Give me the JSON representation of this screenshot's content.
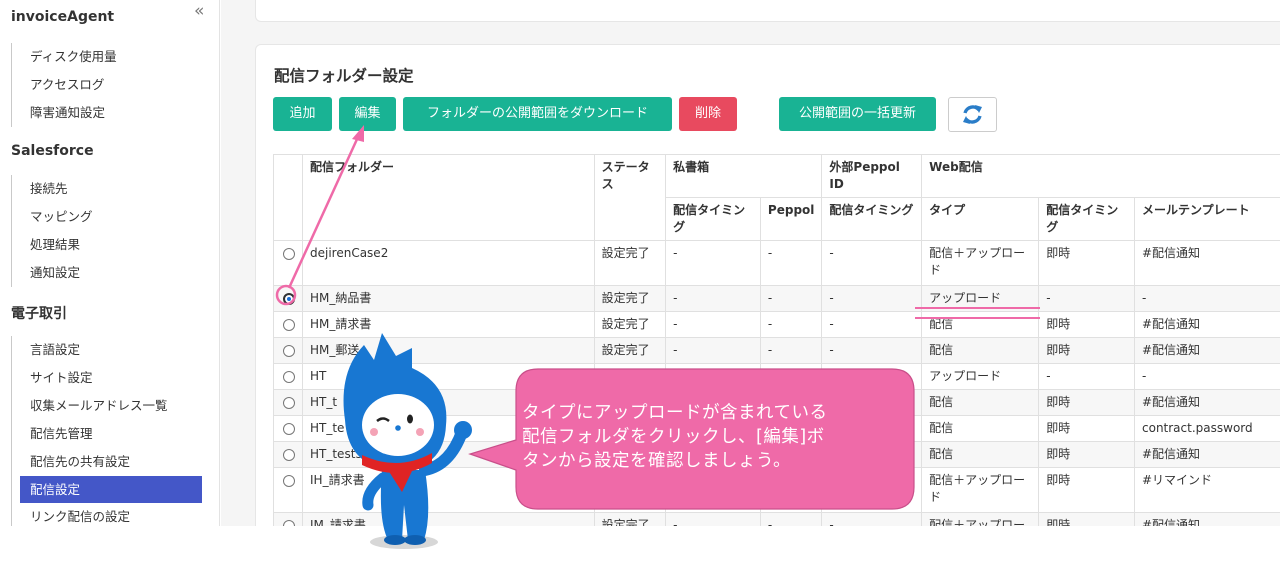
{
  "app": {
    "title": "invoiceAgent"
  },
  "sidebar": {
    "group1": [
      "ディスク使用量",
      "アクセスログ",
      "障害通知設定"
    ],
    "section_salesforce": "Salesforce",
    "group2": [
      "接続先",
      "マッピング",
      "処理結果",
      "通知設定"
    ],
    "section_edi": "電子取引",
    "group3": [
      "言語設定",
      "サイト設定",
      "収集メールアドレス一覧",
      "配信先管理",
      "配信先の共有設定",
      "配信設定",
      "リンク配信の設定"
    ],
    "active_item": "配信設定"
  },
  "main": {
    "title": "配信フォルダー設定",
    "buttons": {
      "add": "追加",
      "edit": "編集",
      "download": "フォルダーの公開範囲をダウンロード",
      "delete": "削除",
      "bulk_update": "公開範囲の一括更新"
    },
    "table": {
      "headers": {
        "folder": "配信フォルダー",
        "status": "ステータス",
        "private_box": "私書箱",
        "external_peppol": "外部Peppol ID",
        "web": "Web配信",
        "timing": "配信タイミング",
        "peppol": "Peppol",
        "timing2": "配信タイミング",
        "type": "タイプ",
        "timing3": "配信タイミング",
        "mail_template": "メールテンプレート"
      },
      "rows": [
        {
          "folder": "dejirenCase2",
          "status": "設定完了",
          "pb_timing": "-",
          "pb_peppol": "-",
          "ext_timing": "-",
          "type": "配信＋アップロード",
          "timing": "即時",
          "template": "#配信通知",
          "selected": false
        },
        {
          "folder": "HM_納品書",
          "status": "設定完了",
          "pb_timing": "-",
          "pb_peppol": "-",
          "ext_timing": "-",
          "type": "アップロード",
          "timing": "-",
          "template": "-",
          "selected": true
        },
        {
          "folder": "HM_請求書",
          "status": "設定完了",
          "pb_timing": "-",
          "pb_peppol": "-",
          "ext_timing": "-",
          "type": "配信",
          "timing": "即時",
          "template": "#配信通知",
          "selected": false
        },
        {
          "folder": "HM_郵送",
          "status": "設定完了",
          "pb_timing": "-",
          "pb_peppol": "-",
          "ext_timing": "-",
          "type": "配信",
          "timing": "即時",
          "template": "#配信通知",
          "selected": false
        },
        {
          "folder": "HT",
          "status": "設定完了",
          "pb_timing": "-",
          "pb_peppol": "-",
          "ext_timing": "-",
          "type": "アップロード",
          "timing": "-",
          "template": "-",
          "selected": false
        },
        {
          "folder": "HT_t",
          "status": "",
          "pb_timing": "",
          "pb_peppol": "",
          "ext_timing": "",
          "type": "配信",
          "timing": "即時",
          "template": "#配信通知",
          "selected": false
        },
        {
          "folder": "HT_te",
          "status": "",
          "pb_timing": "",
          "pb_peppol": "",
          "ext_timing": "",
          "type": "配信",
          "timing": "即時",
          "template": "contract.password",
          "selected": false
        },
        {
          "folder": "HT_test3",
          "status": "",
          "pb_timing": "",
          "pb_peppol": "",
          "ext_timing": "",
          "type": "配信",
          "timing": "即時",
          "template": "#配信通知",
          "selected": false
        },
        {
          "folder": "IH_請求書",
          "status": "",
          "pb_timing": "",
          "pb_peppol": "",
          "ext_timing": "",
          "type": "配信＋アップロード",
          "timing": "即時",
          "template": "#リマインド",
          "selected": false
        },
        {
          "folder": "IM_請求書",
          "status": "設定完了",
          "pb_timing": "-",
          "pb_peppol": "-",
          "ext_timing": "-",
          "type": "配信＋アップロー",
          "timing": "即時",
          "template": "#配信通知",
          "selected": false
        }
      ]
    }
  },
  "callout": {
    "line1": "タイプにアップロードが含まれている",
    "line2": "配信フォルダをクリックし、[編集]ボ",
    "line3": "タンから設定を確認しましょう。"
  },
  "colors": {
    "teal": "#19b394",
    "red": "#e84a5f",
    "active_nav": "#4457c8",
    "callout_pink": "#ef6aa8",
    "mascot_blue": "#1877d2"
  }
}
